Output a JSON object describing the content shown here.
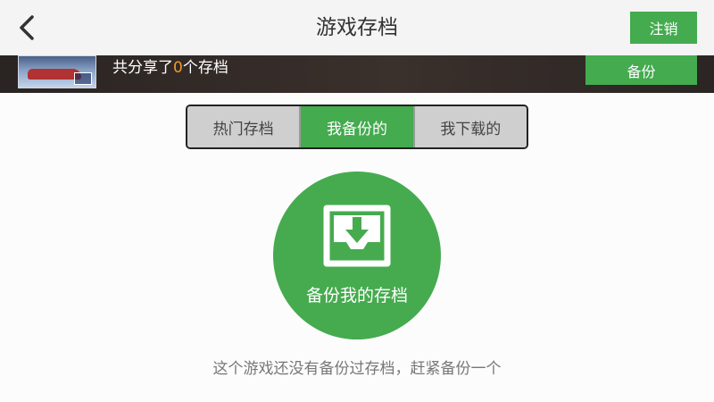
{
  "header": {
    "title": "游戏存档",
    "logout_label": "注销"
  },
  "banner": {
    "share_prefix": "共分享了",
    "share_count": "0",
    "share_suffix": "个存档",
    "backup_label": "备份"
  },
  "tabs": [
    {
      "label": "热门存档",
      "active": false
    },
    {
      "label": "我备份的",
      "active": true
    },
    {
      "label": "我下载的",
      "active": false
    }
  ],
  "backup_action": {
    "label": "备份我的存档"
  },
  "empty_hint": "这个游戏还没有备份过存档，赶紧备份一个",
  "colors": {
    "accent": "#44ab4f",
    "count_highlight": "#f39a2a"
  }
}
